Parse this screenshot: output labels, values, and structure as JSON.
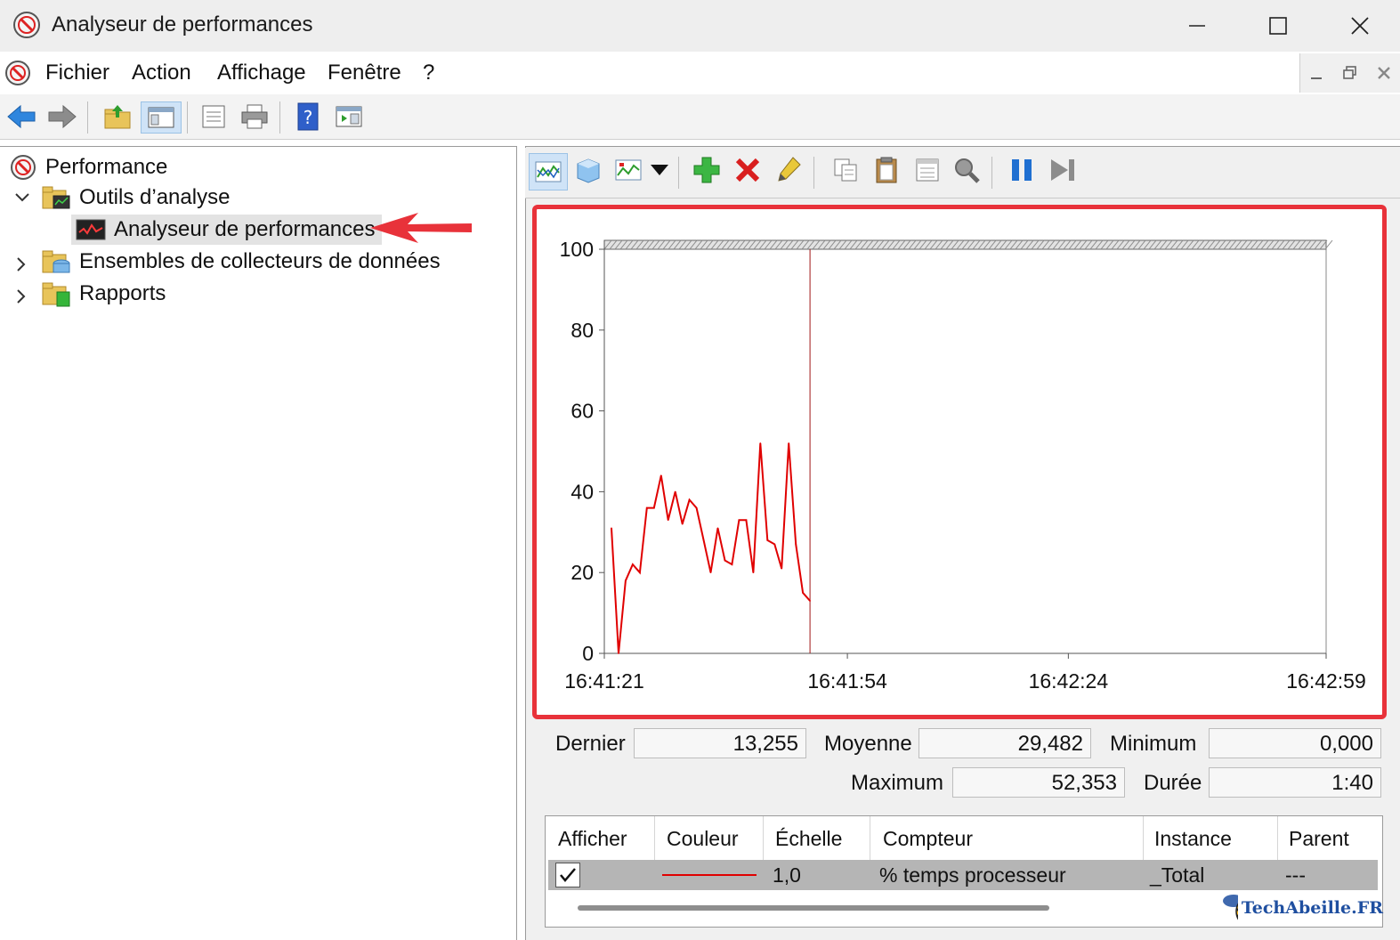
{
  "window": {
    "title": "Analyseur de performances"
  },
  "menu": {
    "items": [
      "Fichier",
      "Action",
      "Affichage",
      "Fenêtre",
      "?"
    ]
  },
  "tree": {
    "root": "Performance",
    "items": [
      {
        "label": "Outils d’analyse",
        "expanded": true
      },
      {
        "label": "Analyseur de performances",
        "selected": true
      },
      {
        "label": "Ensembles de collecteurs de données",
        "expanded": false
      },
      {
        "label": "Rapports",
        "expanded": false
      }
    ]
  },
  "chart_data": {
    "type": "line",
    "title": "",
    "xlabel": "",
    "ylabel": "",
    "ylim": [
      0,
      100
    ],
    "yticks": [
      "0",
      "20",
      "40",
      "60",
      "80",
      "100"
    ],
    "xticks": [
      "16:41:21",
      "16:41:54",
      "16:42:24",
      "16:42:59"
    ],
    "grid": false,
    "legend": "none",
    "cursor_time": "16:41:54",
    "series": [
      {
        "color": "#e00000",
        "values": [
          31,
          0,
          18,
          22,
          20,
          36,
          36,
          44,
          33,
          40,
          32,
          38,
          36,
          28,
          20,
          31,
          23,
          22,
          33,
          33,
          20,
          52,
          28,
          27,
          21,
          52,
          27,
          15,
          13
        ]
      }
    ]
  },
  "stats": {
    "dernier_label": "Dernier",
    "dernier": "13,255",
    "moyenne_label": "Moyenne",
    "moyenne": "29,482",
    "minimum_label": "Minimum",
    "minimum": "0,000",
    "maximum_label": "Maximum",
    "maximum": "52,353",
    "duree_label": "Durée",
    "duree": "1:40"
  },
  "legend": {
    "headers": [
      "Afficher",
      "Couleur",
      "Échelle",
      "Compteur",
      "Instance",
      "Parent"
    ],
    "row": {
      "checked": true,
      "color": "#e00000",
      "scale": "1,0",
      "counter": "% temps processeur",
      "instance": "_Total",
      "parent": "---"
    }
  },
  "watermark": "TechAbeille.FR"
}
